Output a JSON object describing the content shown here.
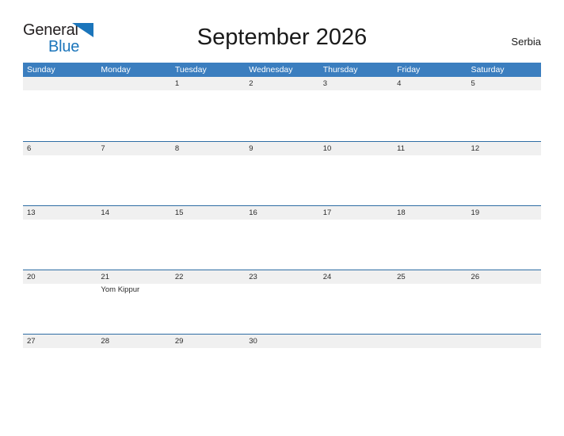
{
  "brand": {
    "name_part1": "General",
    "name_part2": "Blue",
    "flag_icon": "blue-triangle-flag-icon",
    "accent_color": "#1b75bb"
  },
  "header": {
    "title": "September 2026",
    "region": "Serbia"
  },
  "theme": {
    "header_blue": "#3b7ebf",
    "row_line_blue": "#2e6da4",
    "daynum_band_gray": "#f0f0f0",
    "text_color": "#2b2b2b"
  },
  "calendar": {
    "weekdays": [
      "Sunday",
      "Monday",
      "Tuesday",
      "Wednesday",
      "Thursday",
      "Friday",
      "Saturday"
    ],
    "weeks": [
      {
        "days": [
          {
            "num": "",
            "events": []
          },
          {
            "num": "",
            "events": []
          },
          {
            "num": "1",
            "events": []
          },
          {
            "num": "2",
            "events": []
          },
          {
            "num": "3",
            "events": []
          },
          {
            "num": "4",
            "events": []
          },
          {
            "num": "5",
            "events": []
          }
        ]
      },
      {
        "days": [
          {
            "num": "6",
            "events": []
          },
          {
            "num": "7",
            "events": []
          },
          {
            "num": "8",
            "events": []
          },
          {
            "num": "9",
            "events": []
          },
          {
            "num": "10",
            "events": []
          },
          {
            "num": "11",
            "events": []
          },
          {
            "num": "12",
            "events": []
          }
        ]
      },
      {
        "days": [
          {
            "num": "13",
            "events": []
          },
          {
            "num": "14",
            "events": []
          },
          {
            "num": "15",
            "events": []
          },
          {
            "num": "16",
            "events": []
          },
          {
            "num": "17",
            "events": []
          },
          {
            "num": "18",
            "events": []
          },
          {
            "num": "19",
            "events": []
          }
        ]
      },
      {
        "days": [
          {
            "num": "20",
            "events": []
          },
          {
            "num": "21",
            "events": [
              "Yom Kippur"
            ]
          },
          {
            "num": "22",
            "events": []
          },
          {
            "num": "23",
            "events": []
          },
          {
            "num": "24",
            "events": []
          },
          {
            "num": "25",
            "events": []
          },
          {
            "num": "26",
            "events": []
          }
        ]
      },
      {
        "days": [
          {
            "num": "27",
            "events": []
          },
          {
            "num": "28",
            "events": []
          },
          {
            "num": "29",
            "events": []
          },
          {
            "num": "30",
            "events": []
          },
          {
            "num": "",
            "events": []
          },
          {
            "num": "",
            "events": []
          },
          {
            "num": "",
            "events": []
          }
        ]
      }
    ]
  }
}
